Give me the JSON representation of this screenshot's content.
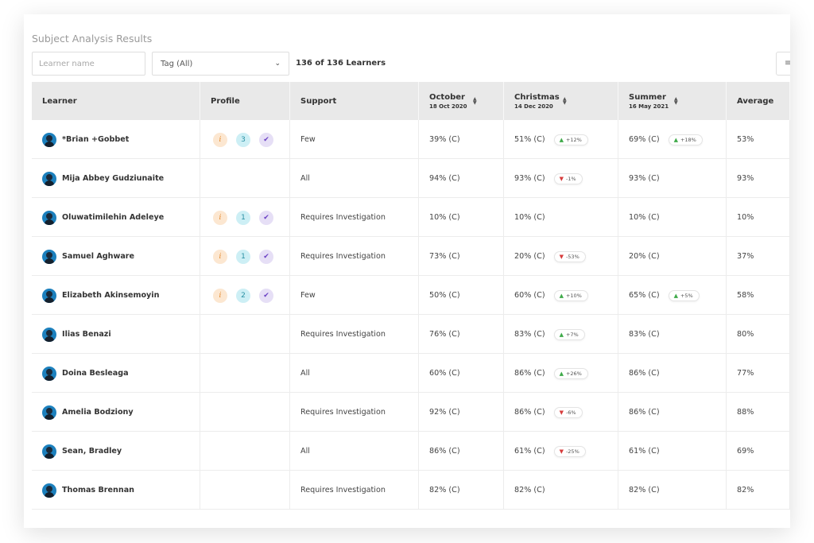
{
  "page": {
    "title": "Subject Analysis Results"
  },
  "filters": {
    "learner_placeholder": "Learner name",
    "tag_label": "Tag (All)",
    "count_text": "136 of 136 Learners"
  },
  "columns": [
    {
      "label": "Learner",
      "sub": ""
    },
    {
      "label": "Profile",
      "sub": ""
    },
    {
      "label": "Support",
      "sub": ""
    },
    {
      "label": "October",
      "sub": "18 Oct 2020",
      "sortable": true
    },
    {
      "label": "Christmas",
      "sub": "14 Dec 2020",
      "sortable": true
    },
    {
      "label": "Summer",
      "sub": "16 May 2021",
      "sortable": true
    },
    {
      "label": "Average",
      "sub": ""
    }
  ],
  "rows": [
    {
      "name": "*Brian +Gobbet",
      "profile": {
        "info": "i",
        "count": "3"
      },
      "support": "Few",
      "october": "39% (C)",
      "christmas": "51% (C)",
      "christmas_change": {
        "dir": "up",
        "text": "+12%"
      },
      "summer": "69% (C)",
      "summer_change": {
        "dir": "up",
        "text": "+18%"
      },
      "average": "53%"
    },
    {
      "name": "Mija Abbey Gudziunaite",
      "profile": null,
      "support": "All",
      "october": "94% (C)",
      "christmas": "93% (C)",
      "christmas_change": {
        "dir": "down",
        "text": "-1%"
      },
      "summer": "93% (C)",
      "summer_change": null,
      "average": "93%"
    },
    {
      "name": "Oluwatimilehin Adeleye",
      "profile": {
        "info": "i",
        "count": "1"
      },
      "support": "Requires Investigation",
      "october": "10% (C)",
      "christmas": "10% (C)",
      "christmas_change": null,
      "summer": "10% (C)",
      "summer_change": null,
      "average": "10%"
    },
    {
      "name": "Samuel Aghware",
      "profile": {
        "info": "i",
        "count": "1"
      },
      "support": "Requires Investigation",
      "october": "73% (C)",
      "christmas": "20% (C)",
      "christmas_change": {
        "dir": "down",
        "text": "-53%"
      },
      "summer": "20% (C)",
      "summer_change": null,
      "average": "37%"
    },
    {
      "name": "Elizabeth Akinsemoyin",
      "profile": {
        "info": "i",
        "count": "2"
      },
      "support": "Few",
      "october": "50% (C)",
      "christmas": "60% (C)",
      "christmas_change": {
        "dir": "up",
        "text": "+10%"
      },
      "summer": "65% (C)",
      "summer_change": {
        "dir": "up",
        "text": "+5%"
      },
      "average": "58%"
    },
    {
      "name": "Ilias Benazi",
      "profile": null,
      "support": "Requires Investigation",
      "october": "76% (C)",
      "christmas": "83% (C)",
      "christmas_change": {
        "dir": "up",
        "text": "+7%"
      },
      "summer": "83% (C)",
      "summer_change": null,
      "average": "80%"
    },
    {
      "name": "Doina Besleaga",
      "profile": null,
      "support": "All",
      "october": "60% (C)",
      "christmas": "86% (C)",
      "christmas_change": {
        "dir": "up",
        "text": "+26%"
      },
      "summer": "86% (C)",
      "summer_change": null,
      "average": "77%"
    },
    {
      "name": "Amelia Bodziony",
      "profile": null,
      "support": "Requires Investigation",
      "october": "92% (C)",
      "christmas": "86% (C)",
      "christmas_change": {
        "dir": "down",
        "text": "-6%"
      },
      "summer": "86% (C)",
      "summer_change": null,
      "average": "88%"
    },
    {
      "name": "Sean, Bradley",
      "profile": null,
      "support": "All",
      "october": "86% (C)",
      "christmas": "61% (C)",
      "christmas_change": {
        "dir": "down",
        "text": "-25%"
      },
      "summer": "61% (C)",
      "summer_change": null,
      "average": "69%"
    },
    {
      "name": "Thomas Brennan",
      "profile": null,
      "support": "Requires Investigation",
      "october": "82% (C)",
      "christmas": "82% (C)",
      "christmas_change": null,
      "summer": "82% (C)",
      "summer_change": null,
      "average": "82%"
    }
  ],
  "colors": {
    "header_bg": "#e9e9e9",
    "avatar": "#1c80bd",
    "up": "#3faa4a",
    "down": "#d73c3c",
    "info_badge": "#fce7d1",
    "count_badge": "#cdeff5",
    "check_badge": "#e6dff6"
  },
  "icons": {
    "info": "info-icon",
    "check": "check-icon",
    "up": "triangle-up-icon",
    "down": "triangle-down-icon",
    "sort": "sort-icon",
    "select": "chevron-down-icon"
  }
}
